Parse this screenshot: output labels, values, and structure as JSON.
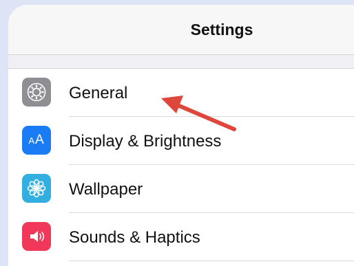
{
  "header": {
    "title": "Settings"
  },
  "settings_items": [
    {
      "label": "General",
      "icon": "gear-icon",
      "icon_color": "#8e8e93"
    },
    {
      "label": "Display & Brightness",
      "icon": "display-text-size-icon",
      "icon_color": "#1a7cf5",
      "icon_text_small": "A",
      "icon_text_large": "A"
    },
    {
      "label": "Wallpaper",
      "icon": "flower-icon",
      "icon_color": "#32aee0"
    },
    {
      "label": "Sounds & Haptics",
      "icon": "speaker-icon",
      "icon_color": "#f2385a"
    }
  ],
  "colors": {
    "background": "#dde4f5",
    "annotation_arrow": "#e0473c"
  }
}
